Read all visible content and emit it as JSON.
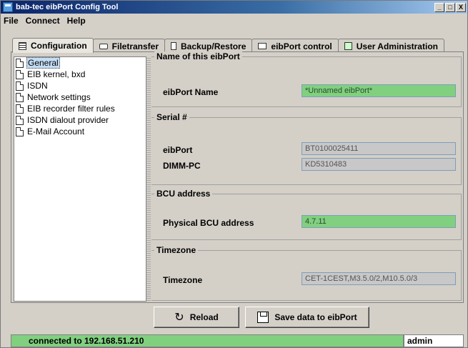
{
  "window": {
    "title": "bab-tec eibPort Config Tool",
    "controls": [
      "_",
      "□",
      "X"
    ]
  },
  "menu": {
    "items": [
      "File",
      "Connect",
      "Help"
    ]
  },
  "tabs": [
    {
      "label": "Configuration",
      "icon": "configuration-icon",
      "active": true
    },
    {
      "label": "Filetransfer",
      "icon": "filetransfer-icon"
    },
    {
      "label": "Backup/Restore",
      "icon": "backup-icon"
    },
    {
      "label": "eibPort control",
      "icon": "monitor-icon"
    },
    {
      "label": "User Administration",
      "icon": "user-icon"
    }
  ],
  "tree": {
    "items": [
      {
        "label": "General",
        "selected": true
      },
      {
        "label": "EIB kernel, bxd"
      },
      {
        "label": "ISDN"
      },
      {
        "label": "Network settings"
      },
      {
        "label": "EIB recorder filter rules"
      },
      {
        "label": "ISDN dialout provider"
      },
      {
        "label": "E-Mail Account"
      }
    ]
  },
  "groups": {
    "name": {
      "title": "Name of this eibPort",
      "fields": [
        {
          "label": "eibPort Name",
          "value": "*Unnamed eibPort*",
          "editable": true
        }
      ]
    },
    "serial": {
      "title": "Serial #",
      "fields": [
        {
          "label": "eibPort",
          "value": "BT0100025411",
          "editable": false
        },
        {
          "label": "DIMM-PC",
          "value": "KD5310483",
          "editable": false
        }
      ]
    },
    "bcu": {
      "title": "BCU address",
      "fields": [
        {
          "label": "Physical BCU address",
          "value": "4.7.11",
          "editable": true
        }
      ]
    },
    "timezone": {
      "title": "Timezone",
      "fields": [
        {
          "label": "Timezone",
          "value": "CET-1CEST,M3.5.0/2,M10.5.0/3",
          "editable": false
        }
      ]
    }
  },
  "buttons": {
    "reload": "Reload",
    "save": "Save data to eibPort"
  },
  "status": {
    "connection": "connected to 192.168.51.210",
    "user": "admin"
  },
  "colors": {
    "editable_field": "#80d080",
    "readonly_field": "#c8c8c8",
    "titlebar": "#0a246a"
  }
}
